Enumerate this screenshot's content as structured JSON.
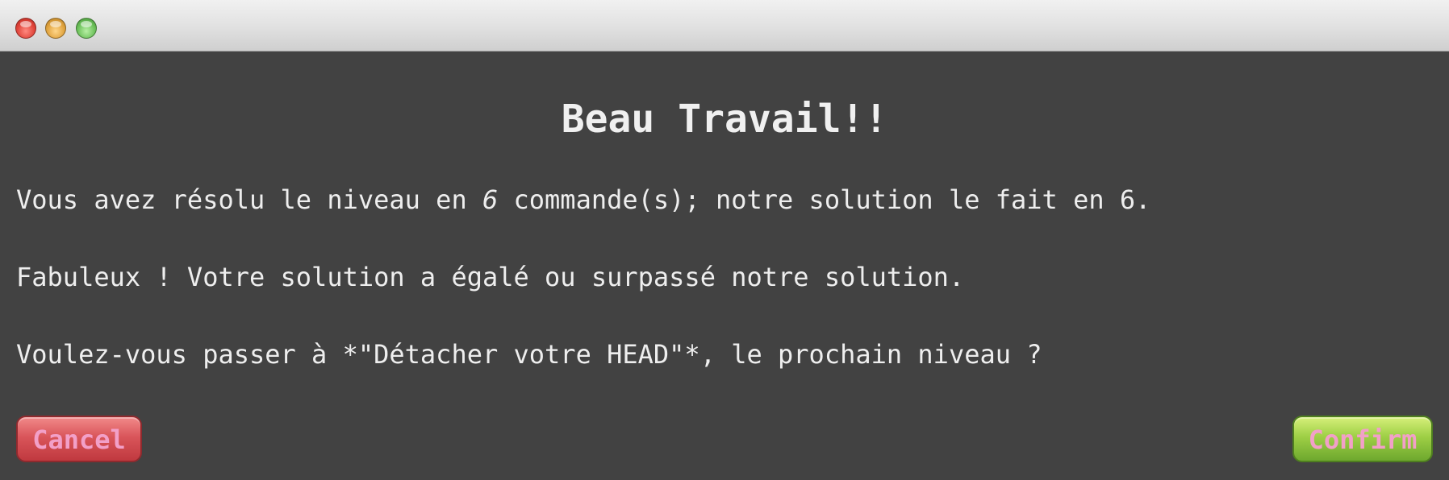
{
  "dialog": {
    "heading": "Beau Travail!!",
    "line1_pre": "Vous avez résolu le niveau en ",
    "line1_count": "6",
    "line1_post": " commande(s); notre solution le fait en 6.",
    "line2": "Fabuleux ! Votre solution a égalé ou surpassé notre solution.",
    "line3": "Voulez-vous passer à *\"Détacher votre HEAD\"*, le prochain niveau ?"
  },
  "buttons": {
    "cancel": "Cancel",
    "confirm": "Confirm"
  },
  "colors": {
    "background": "#424242",
    "text": "#eeeeee",
    "button_text": "#f2a0c8",
    "cancel": "#d9555a",
    "confirm": "#9ecf45"
  }
}
